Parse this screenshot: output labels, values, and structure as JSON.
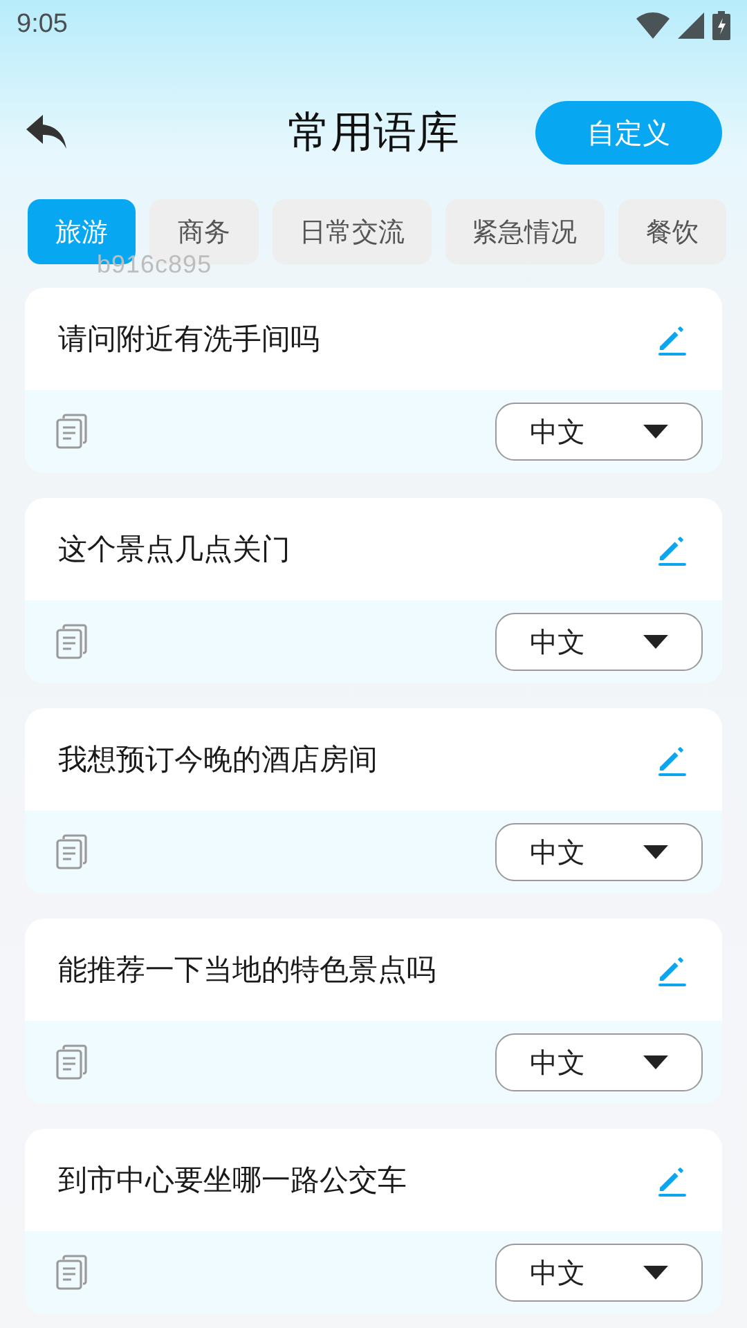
{
  "status_bar": {
    "time": "9:05"
  },
  "header": {
    "title": "常用语库",
    "action": "自定义"
  },
  "tabs": [
    {
      "label": "旅游",
      "selected": true
    },
    {
      "label": "商务",
      "selected": false
    },
    {
      "label": "日常交流",
      "selected": false
    },
    {
      "label": "紧急情况",
      "selected": false
    },
    {
      "label": "餐饮",
      "selected": false
    }
  ],
  "overlay_code": "b916c895",
  "phrases": [
    {
      "text": "请问附近有洗手间吗",
      "language": "中文"
    },
    {
      "text": "这个景点几点关门",
      "language": "中文"
    },
    {
      "text": "我想预订今晚的酒店房间",
      "language": "中文"
    },
    {
      "text": "能推荐一下当地的特色景点吗",
      "language": "中文"
    },
    {
      "text": "到市中心要坐哪一路公交车",
      "language": "中文"
    }
  ]
}
